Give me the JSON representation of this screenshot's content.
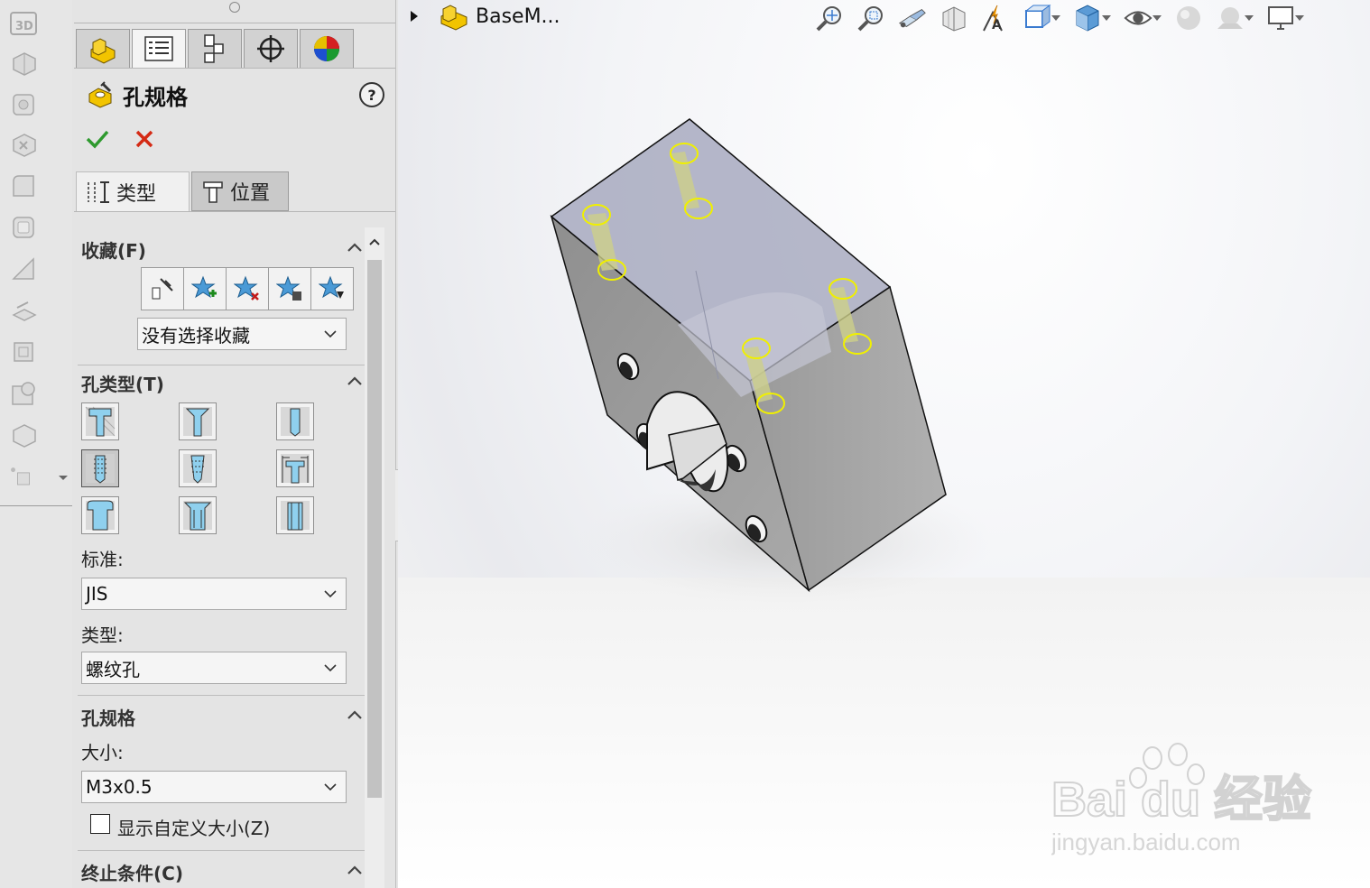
{
  "panel": {
    "title": "孔规格",
    "help": "?",
    "subtabs": {
      "type": "类型",
      "position": "位置"
    }
  },
  "favorites": {
    "header": "收藏(F)",
    "dropdown": "没有选择收藏"
  },
  "hole_type": {
    "header": "孔类型(T)",
    "standard_label": "标准:",
    "standard_value": "JIS",
    "type_label": "类型:",
    "type_value": "螺纹孔"
  },
  "hole_spec": {
    "header": "孔规格",
    "size_label": "大小:",
    "size_value": "M3x0.5",
    "custom_size_label": "显示自定义大小(Z)",
    "custom_size_checked": false
  },
  "end_condition": {
    "header": "终止条件(C)"
  },
  "graphics": {
    "part_name": "BaseM...",
    "accent_highlight": "#f0f000",
    "model_face_color": "#a6a6a6"
  },
  "watermark": {
    "logo_text": "Bai du 经验",
    "url_text": "jingyan.baidu.com"
  }
}
